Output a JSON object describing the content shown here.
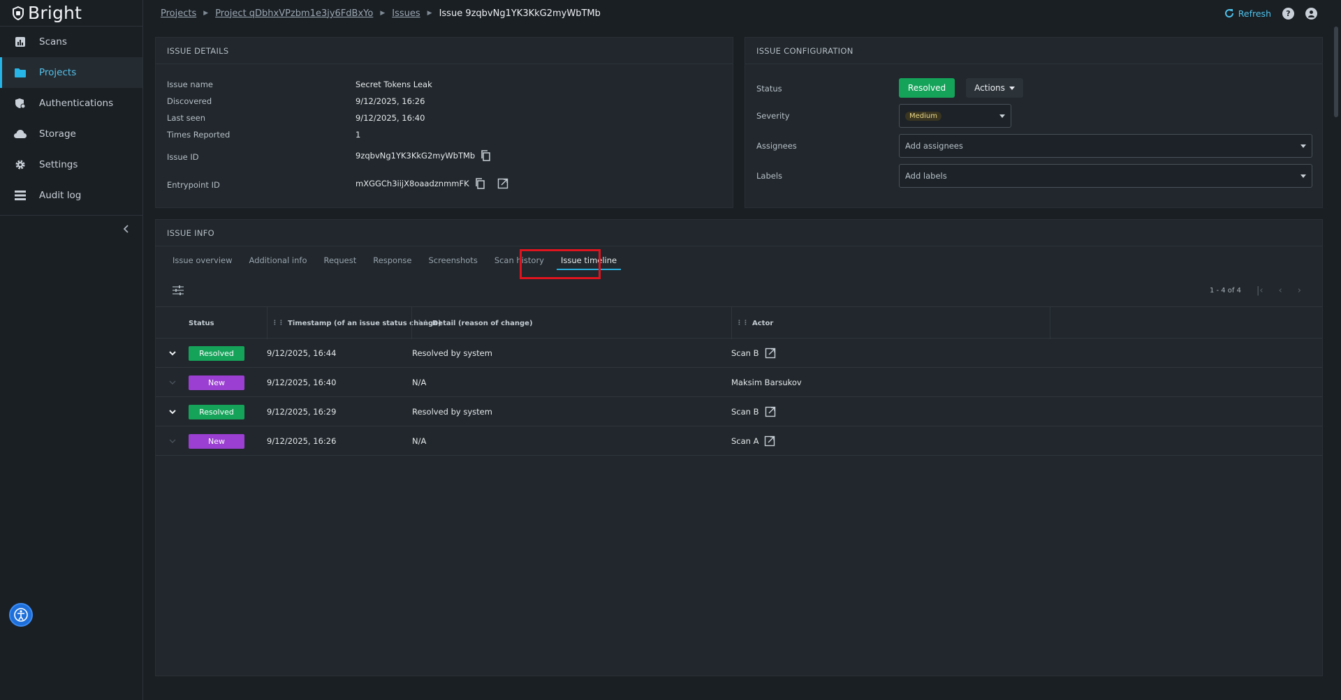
{
  "brand": "Bright",
  "nav": [
    {
      "label": "Scans",
      "icon": "chart-icon",
      "active": false
    },
    {
      "label": "Projects",
      "icon": "folder-icon",
      "active": true
    },
    {
      "label": "Authentications",
      "icon": "shield-gear-icon",
      "active": false
    },
    {
      "label": "Storage",
      "icon": "cloud-icon",
      "active": false
    },
    {
      "label": "Settings",
      "icon": "gear-icon",
      "active": false
    },
    {
      "label": "Audit log",
      "icon": "list-icon",
      "active": false
    }
  ],
  "breadcrumb": {
    "items": [
      "Projects",
      "Project qDbhxVPzbm1e3jy6FdBxYo",
      "Issues"
    ],
    "current": "Issue 9zqbvNg1YK3KkG2myWbTMb"
  },
  "topbar": {
    "refresh_label": "Refresh"
  },
  "issue_details": {
    "title": "ISSUE DETAILS",
    "fields": {
      "issue_name_label": "Issue name",
      "issue_name": "Secret Tokens Leak",
      "discovered_label": "Discovered",
      "discovered": "9/12/2025, 16:26",
      "last_seen_label": "Last seen",
      "last_seen": "9/12/2025, 16:40",
      "times_reported_label": "Times Reported",
      "times_reported": "1",
      "issue_id_label": "Issue ID",
      "issue_id": "9zqbvNg1YK3KkG2myWbTMb",
      "entrypoint_id_label": "Entrypoint ID",
      "entrypoint_id": "mXGGCh3iijX8oaadznmmFK"
    }
  },
  "issue_config": {
    "title": "ISSUE CONFIGURATION",
    "status_label": "Status",
    "status_value": "Resolved",
    "actions_label": "Actions",
    "severity_label": "Severity",
    "severity_value": "Medium",
    "assignees_label": "Assignees",
    "assignees_placeholder": "Add assignees",
    "labels_label": "Labels",
    "labels_placeholder": "Add labels"
  },
  "issue_info": {
    "title": "ISSUE INFO",
    "tabs": [
      "Issue overview",
      "Additional info",
      "Request",
      "Response",
      "Screenshots",
      "Scan history",
      "Issue timeline"
    ],
    "active_tab": "Issue timeline",
    "pager": "1 - 4 of 4",
    "columns": [
      "Status",
      "Timestamp (of an issue status change)",
      "Detail (reason of change)",
      "Actor"
    ],
    "rows": [
      {
        "status": "Resolved",
        "color": "#15a35a",
        "timestamp": "9/12/2025, 16:44",
        "detail": "Resolved by system",
        "actor": "Scan B",
        "link": true,
        "expandable": true
      },
      {
        "status": "New",
        "color": "#9a3fd1",
        "timestamp": "9/12/2025, 16:40",
        "detail": "N/A",
        "actor": "Maksim Barsukov",
        "link": false,
        "expandable": false
      },
      {
        "status": "Resolved",
        "color": "#15a35a",
        "timestamp": "9/12/2025, 16:29",
        "detail": "Resolved by system",
        "actor": "Scan B",
        "link": true,
        "expandable": true
      },
      {
        "status": "New",
        "color": "#9a3fd1",
        "timestamp": "9/12/2025, 16:26",
        "detail": "N/A",
        "actor": "Scan A",
        "link": true,
        "expandable": false
      }
    ]
  }
}
